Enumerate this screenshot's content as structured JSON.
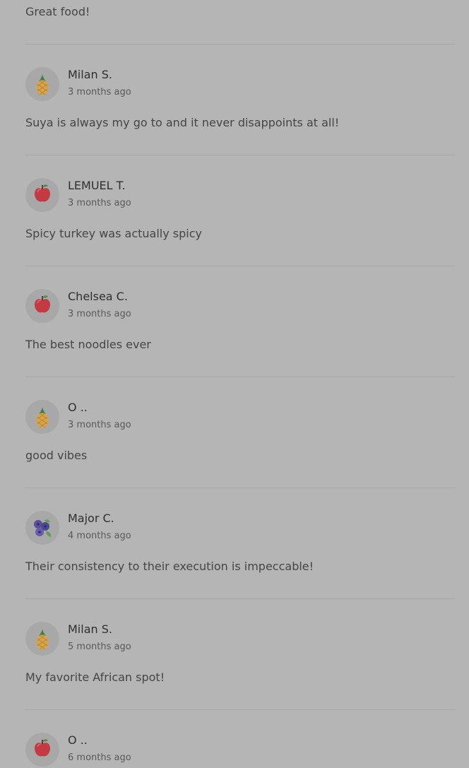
{
  "top_comment": "Great food!",
  "reviews": [
    {
      "name": "Milan S.",
      "time": "3 months ago",
      "text": "Suya is always my go to and it never disappoints at all!",
      "avatar_icon": "pineapple-icon"
    },
    {
      "name": "LEMUEL T.",
      "time": "3 months ago",
      "text": "Spicy turkey was actually spicy",
      "avatar_icon": "apple-icon"
    },
    {
      "name": "Chelsea C.",
      "time": "3 months ago",
      "text": "The best noodles ever",
      "avatar_icon": "apple-icon"
    },
    {
      "name": "O ..",
      "time": "3 months ago",
      "text": "good vibes",
      "avatar_icon": "pineapple-icon"
    },
    {
      "name": "Major C.",
      "time": "4 months ago",
      "text": "Their consistency to their execution is impeccable!",
      "avatar_icon": "blueberry-icon"
    },
    {
      "name": "Milan S.",
      "time": "5 months ago",
      "text": "My favorite African spot!",
      "avatar_icon": "pineapple-icon"
    },
    {
      "name": "O ..",
      "time": "6 months ago",
      "text": "",
      "avatar_icon": "apple-icon"
    }
  ]
}
